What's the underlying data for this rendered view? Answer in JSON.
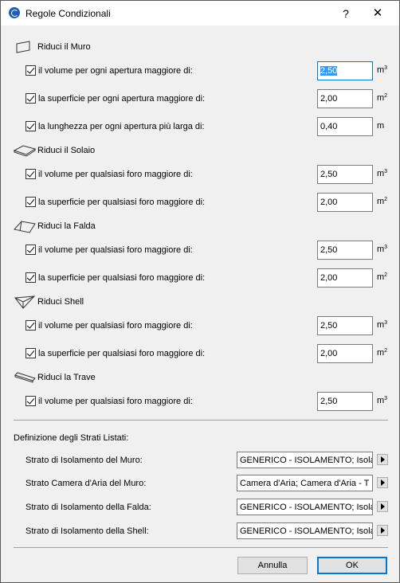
{
  "window": {
    "title": "Regole Condizionali",
    "help": "?",
    "close": "✕"
  },
  "sections": [
    {
      "label": "Riduci il Muro",
      "icon": "wall-icon"
    },
    {
      "label": "Riduci il Solaio",
      "icon": "slab-icon"
    },
    {
      "label": "Riduci la Falda",
      "icon": "roof-icon"
    },
    {
      "label": "Riduci Shell",
      "icon": "shell-icon"
    },
    {
      "label": "Riduci la Trave",
      "icon": "beam-icon"
    }
  ],
  "rows": [
    {
      "label": "il volume per ogni apertura maggiore di:",
      "value": "2,50",
      "unit": "m",
      "sup": "3",
      "checked": true
    },
    {
      "label": "la superficie per ogni apertura maggiore di:",
      "value": "2,00",
      "unit": "m",
      "sup": "2",
      "checked": true
    },
    {
      "label": "la lunghezza per ogni apertura più larga di:",
      "value": "0,40",
      "unit": "m",
      "sup": "",
      "checked": true
    },
    {
      "label": "il volume per qualsiasi foro maggiore di:",
      "value": "2,50",
      "unit": "m",
      "sup": "3",
      "checked": true
    },
    {
      "label": "la superficie per qualsiasi foro maggiore di:",
      "value": "2,00",
      "unit": "m",
      "sup": "2",
      "checked": true
    },
    {
      "label": "il volume per qualsiasi foro maggiore di:",
      "value": "2,50",
      "unit": "m",
      "sup": "3",
      "checked": true
    },
    {
      "label": "la superficie per qualsiasi foro maggiore di:",
      "value": "2,00",
      "unit": "m",
      "sup": "2",
      "checked": true
    },
    {
      "label": "il volume per qualsiasi foro maggiore di:",
      "value": "2,50",
      "unit": "m",
      "sup": "3",
      "checked": true
    },
    {
      "label": "la superficie per qualsiasi foro maggiore di:",
      "value": "2,00",
      "unit": "m",
      "sup": "2",
      "checked": true
    },
    {
      "label": "il volume per qualsiasi foro maggiore di:",
      "value": "2,50",
      "unit": "m",
      "sup": "3",
      "checked": true
    }
  ],
  "layers": {
    "title": "Definizione degli Strati Listati:",
    "rows": [
      {
        "label": "Strato di Isolamento del Muro:",
        "value": "GENERICO - ISOLAMENTO; Isola"
      },
      {
        "label": "Strato Camera d'Aria del Muro:",
        "value": "Camera d'Aria; Camera d'Aria - T"
      },
      {
        "label": "Strato di Isolamento della Falda:",
        "value": "GENERICO - ISOLAMENTO; Isola"
      },
      {
        "label": "Strato di Isolamento della Shell:",
        "value": "GENERICO - ISOLAMENTO; Isola"
      }
    ]
  },
  "buttons": {
    "cancel": "Annulla",
    "ok": "OK"
  }
}
